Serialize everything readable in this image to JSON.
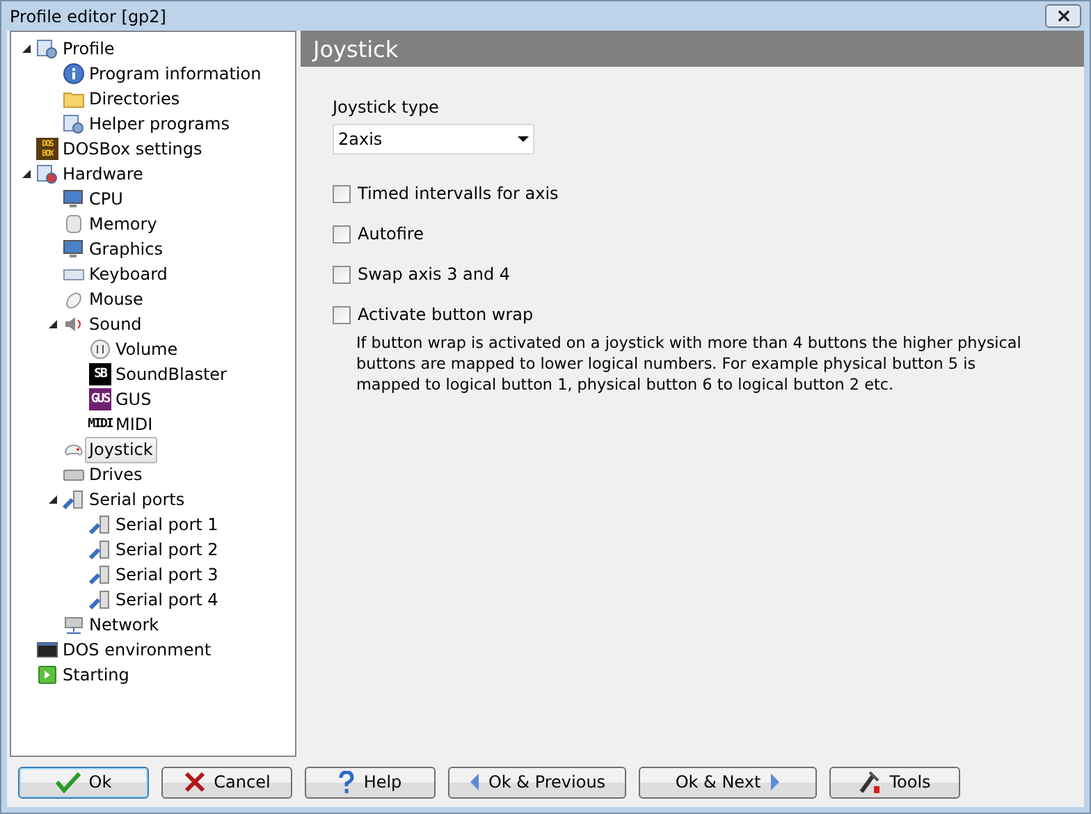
{
  "window": {
    "title": "Profile editor [gp2]"
  },
  "tree": [
    {
      "label": "Profile",
      "kind": "profile",
      "expanded": true,
      "selected": false,
      "children": [
        {
          "label": "Program information",
          "kind": "info",
          "selected": false
        },
        {
          "label": "Directories",
          "kind": "folder",
          "selected": false
        },
        {
          "label": "Helper programs",
          "kind": "profile",
          "selected": false
        }
      ]
    },
    {
      "label": "DOSBox settings",
      "kind": "dosbox",
      "badge": "DOS BOX",
      "selected": false
    },
    {
      "label": "Hardware",
      "kind": "hardware",
      "expanded": true,
      "selected": false,
      "children": [
        {
          "label": "CPU",
          "kind": "cpu",
          "selected": false
        },
        {
          "label": "Memory",
          "kind": "memory",
          "selected": false
        },
        {
          "label": "Graphics",
          "kind": "monitor",
          "selected": false
        },
        {
          "label": "Keyboard",
          "kind": "keyboard",
          "selected": false
        },
        {
          "label": "Mouse",
          "kind": "mouse",
          "selected": false
        },
        {
          "label": "Sound",
          "kind": "speaker",
          "expanded": true,
          "selected": false,
          "children": [
            {
              "label": "Volume",
              "kind": "volume",
              "selected": false
            },
            {
              "label": "SoundBlaster",
              "kind": "sb",
              "badge": "SB",
              "selected": false
            },
            {
              "label": "GUS",
              "kind": "gus",
              "badge": "GUS",
              "selected": false
            },
            {
              "label": "MIDI",
              "kind": "midi",
              "badge": "MIDI",
              "selected": false
            }
          ]
        },
        {
          "label": "Joystick",
          "kind": "joystick",
          "selected": true
        },
        {
          "label": "Drives",
          "kind": "drive",
          "selected": false
        },
        {
          "label": "Serial ports",
          "kind": "serial",
          "expanded": true,
          "selected": false,
          "children": [
            {
              "label": "Serial port 1",
              "kind": "serial",
              "selected": false
            },
            {
              "label": "Serial port 2",
              "kind": "serial",
              "selected": false
            },
            {
              "label": "Serial port 3",
              "kind": "serial",
              "selected": false
            },
            {
              "label": "Serial port 4",
              "kind": "serial",
              "selected": false
            }
          ]
        },
        {
          "label": "Network",
          "kind": "network",
          "selected": false
        }
      ]
    },
    {
      "label": "DOS environment",
      "kind": "console",
      "selected": false
    },
    {
      "label": "Starting",
      "kind": "play",
      "selected": false
    }
  ],
  "panel": {
    "title": "Joystick",
    "joystick_type": {
      "label": "Joystick type",
      "value": "2axis"
    },
    "options": [
      {
        "label": "Timed intervalls for axis",
        "checked": false
      },
      {
        "label": "Autofire",
        "checked": false
      },
      {
        "label": "Swap axis 3 and 4",
        "checked": false
      },
      {
        "label": "Activate button wrap",
        "checked": false,
        "note": "If button wrap is activated on a joystick with more than 4 buttons the higher physical buttons are mapped to lower logical numbers. For example physical button 5 is mapped to logical button 1, physical button 6 to logical button 2 etc."
      }
    ]
  },
  "buttons": [
    {
      "label": "Ok",
      "kind": "ok",
      "default": true
    },
    {
      "label": "Cancel",
      "kind": "cancel",
      "default": false
    },
    {
      "label": "Help",
      "kind": "help",
      "default": false
    },
    {
      "label": "Ok & Previous",
      "kind": "prev",
      "default": false
    },
    {
      "label": "Ok & Next",
      "kind": "next",
      "default": false
    },
    {
      "label": "Tools",
      "kind": "tools",
      "default": false
    }
  ]
}
